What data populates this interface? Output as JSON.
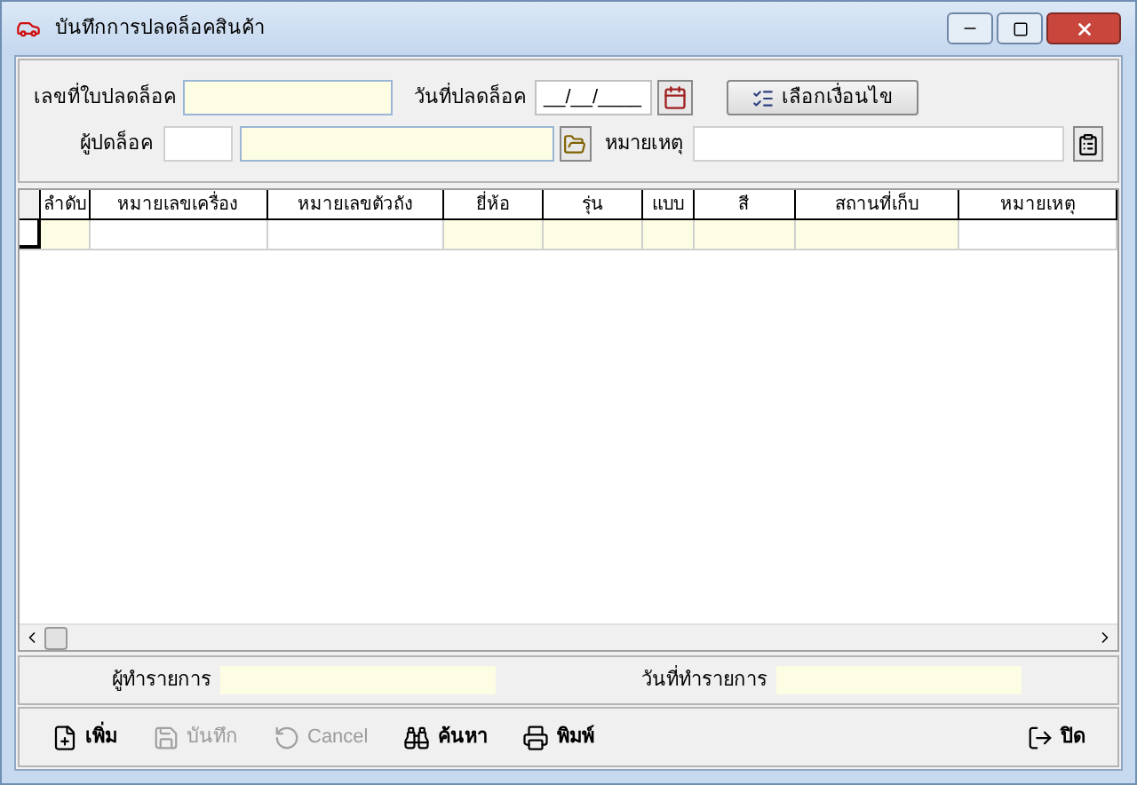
{
  "window": {
    "title": "บันทึกการปลดล็อคสินค้า"
  },
  "header": {
    "doc_no": {
      "label": "เลขที่ใบปลดล็อค"
    },
    "date": {
      "label": "วันที่ปลดล็อค",
      "value": "__/__/____"
    },
    "condition_button": "เลือกเงื่อนไข",
    "unlocker": {
      "label": "ผู้ปดล็อค"
    },
    "remark": {
      "label": "หมายเหตุ"
    }
  },
  "table": {
    "columns": [
      {
        "label": "ลำดับ",
        "shaded": true
      },
      {
        "label": "หมายเลขเครื่อง",
        "shaded": false
      },
      {
        "label": "หมายเลขตัวถัง",
        "shaded": false
      },
      {
        "label": "ยี่ห้อ",
        "shaded": true
      },
      {
        "label": "รุ่น",
        "shaded": true
      },
      {
        "label": "แบบ",
        "shaded": true
      },
      {
        "label": "สี",
        "shaded": true
      },
      {
        "label": "สถานที่เก็บ",
        "shaded": true
      },
      {
        "label": "หมายเหตุ",
        "shaded": false
      }
    ]
  },
  "footer": {
    "operator": {
      "label": "ผู้ทำรายการ"
    },
    "op_date": {
      "label": "วันที่ทำรายการ"
    }
  },
  "toolbar": [
    {
      "kind": "new",
      "label": "เพิ่ม",
      "disabled": false
    },
    {
      "kind": "save",
      "label": "บันทึก",
      "disabled": true
    },
    {
      "kind": "cancel",
      "label": "Cancel",
      "disabled": true
    },
    {
      "kind": "search",
      "label": "ค้นหา",
      "disabled": false
    },
    {
      "kind": "print",
      "label": "พิมพ์",
      "disabled": false
    },
    {
      "kind": "close",
      "label": "ปิด",
      "disabled": false
    }
  ]
}
